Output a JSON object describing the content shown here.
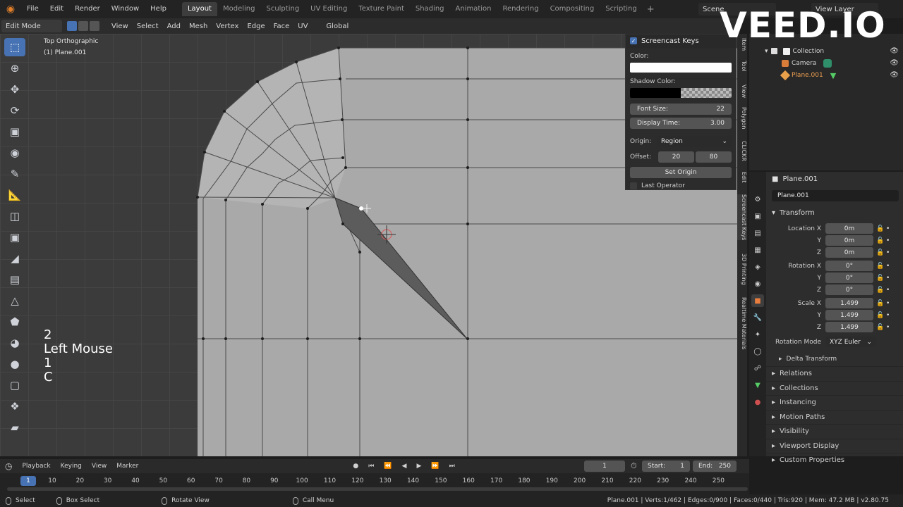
{
  "menubar": {
    "items": [
      "File",
      "Edit",
      "Render",
      "Window",
      "Help"
    ],
    "workspaces": [
      "Layout",
      "Modeling",
      "Sculpting",
      "UV Editing",
      "Texture Paint",
      "Shading",
      "Animation",
      "Rendering",
      "Compositing",
      "Scripting"
    ],
    "active_workspace": "Layout",
    "add_tab": "+",
    "scene": "Scene",
    "view_layer": "View Layer"
  },
  "watermark": "VEED.IO",
  "viewport_header": {
    "mode": "Edit Mode",
    "menus": [
      "View",
      "Select",
      "Add",
      "Mesh",
      "Vertex",
      "Edge",
      "Face",
      "UV"
    ],
    "orientation": "Global"
  },
  "viewport": {
    "view_name": "Top Orthographic",
    "object_label": "(1) Plane.001"
  },
  "screencast_keys_overlay": {
    "lines": [
      "2",
      "Left Mouse",
      "1",
      "C"
    ]
  },
  "screencast_panel": {
    "title": "Screencast Keys",
    "color_label": "Color:",
    "shadow_color_label": "Shadow Color:",
    "font_size_label": "Font Size:",
    "font_size_value": "22",
    "display_time_label": "Display Time:",
    "display_time_value": "3.00",
    "origin_label": "Origin:",
    "origin_value": "Region",
    "offset_label": "Offset:",
    "offset_x": "20",
    "offset_y": "80",
    "set_origin_button": "Set Origin",
    "last_operator_label": "Last Operator"
  },
  "side_tabs": [
    "Item",
    "Tool",
    "View",
    "Polygon",
    "CLICKR",
    "Edit",
    "Screencast Keys",
    "3D Printing",
    "Realtime Materials"
  ],
  "outliner": {
    "collection": "Collection",
    "camera": "Camera",
    "plane": "Plane.001"
  },
  "properties": {
    "header": "Plane.001",
    "object_name": "Plane.001",
    "transform_label": "Transform",
    "location_x_label": "Location X",
    "location_x": "0m",
    "location_y": "0m",
    "location_z": "0m",
    "rotation_x_label": "Rotation X",
    "rotation_x": "0°",
    "rotation_y": "0°",
    "rotation_z": "0°",
    "scale_x_label": "Scale X",
    "scale_x": "1.499",
    "scale_y": "1.499",
    "scale_z": "1.499",
    "y_label": "Y",
    "z_label": "Z",
    "rotation_mode_label": "Rotation Mode",
    "rotation_mode": "XYZ Euler",
    "delta_transform": "Delta Transform",
    "panels": [
      "Relations",
      "Collections",
      "Instancing",
      "Motion Paths",
      "Visibility",
      "Viewport Display",
      "Custom Properties"
    ]
  },
  "timeline": {
    "menus": [
      "Playback",
      "Keying",
      "View",
      "Marker"
    ],
    "current_frame": "1",
    "start_label": "Start:",
    "start": "1",
    "end_label": "End:",
    "end": "250",
    "ruler_current": "1",
    "ruler_ticks": [
      "10",
      "20",
      "30",
      "40",
      "50",
      "60",
      "70",
      "80",
      "90",
      "100",
      "110",
      "120",
      "130",
      "140",
      "150",
      "160",
      "170",
      "180",
      "190",
      "200",
      "210",
      "220",
      "230",
      "240",
      "250"
    ]
  },
  "statusbar": {
    "select": "Select",
    "box_select": "Box Select",
    "rotate_view": "Rotate View",
    "call_menu": "Call Menu",
    "stats": "Plane.001 | Verts:1/462 | Edges:0/900 | Faces:0/440 | Tris:920 | Mem: 47.2 MB | v2.80.75"
  }
}
